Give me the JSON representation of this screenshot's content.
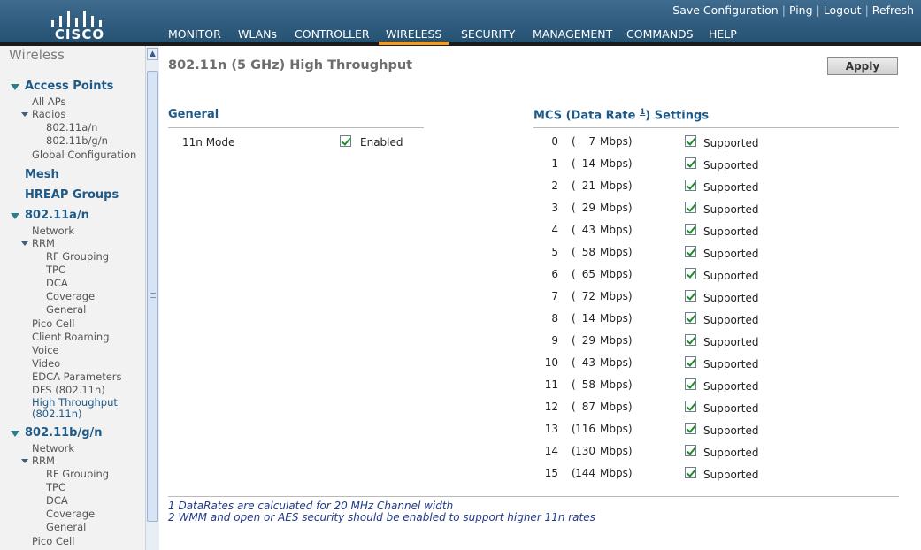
{
  "brand": {
    "logo_text": "CISCO"
  },
  "top_links": [
    "Save Configuration",
    "Ping",
    "Logout",
    "Refresh"
  ],
  "main_nav": [
    "MONITOR",
    "WLANs",
    "CONTROLLER",
    "WIRELESS",
    "SECURITY",
    "MANAGEMENT",
    "COMMANDS",
    "HELP"
  ],
  "active_nav": "WIRELESS",
  "sidebar": {
    "title": "Wireless",
    "items": [
      "Access Points",
      "All APs",
      "Radios",
      "802.11a/n",
      "802.11b/g/n",
      "Global Configuration",
      "Mesh",
      "HREAP Groups",
      "802.11a/n",
      "Network",
      "RRM",
      "RF Grouping",
      "TPC",
      "DCA",
      "Coverage",
      "General",
      "Pico Cell",
      "Client Roaming",
      "Voice",
      "Video",
      "EDCA Parameters",
      "DFS (802.11h)",
      "High Throughput",
      "(802.11n)",
      "802.11b/g/n",
      "Network",
      "RRM",
      "RF Grouping",
      "TPC",
      "DCA",
      "Coverage",
      "General",
      "Pico Cell"
    ]
  },
  "page": {
    "title": "802.11n (5 GHz) High Throughput",
    "apply_label": "Apply"
  },
  "general": {
    "title": "General",
    "mode_label": "11n Mode",
    "mode_value": "Enabled",
    "mode_checked": true
  },
  "mcs": {
    "title_prefix": "MCS (Data Rate ",
    "title_sup": "1",
    "title_suffix": ") Settings",
    "open_paren": "(",
    "unit": "Mbps)",
    "status_label": "Supported",
    "rows": [
      {
        "index": "0",
        "rate": "7"
      },
      {
        "index": "1",
        "rate": "14"
      },
      {
        "index": "2",
        "rate": "21"
      },
      {
        "index": "3",
        "rate": "29"
      },
      {
        "index": "4",
        "rate": "43"
      },
      {
        "index": "5",
        "rate": "58"
      },
      {
        "index": "6",
        "rate": "65"
      },
      {
        "index": "7",
        "rate": "72"
      },
      {
        "index": "8",
        "rate": "14"
      },
      {
        "index": "9",
        "rate": "29"
      },
      {
        "index": "10",
        "rate": "43"
      },
      {
        "index": "11",
        "rate": "58"
      },
      {
        "index": "12",
        "rate": "87"
      },
      {
        "index": "13",
        "rate": "116"
      },
      {
        "index": "14",
        "rate": "130"
      },
      {
        "index": "15",
        "rate": "144"
      }
    ]
  },
  "footnotes": [
    "1 DataRates are calculated for 20 MHz Channel width",
    "2 WMM and open or AES security should be enabled to support higher 11n rates"
  ]
}
